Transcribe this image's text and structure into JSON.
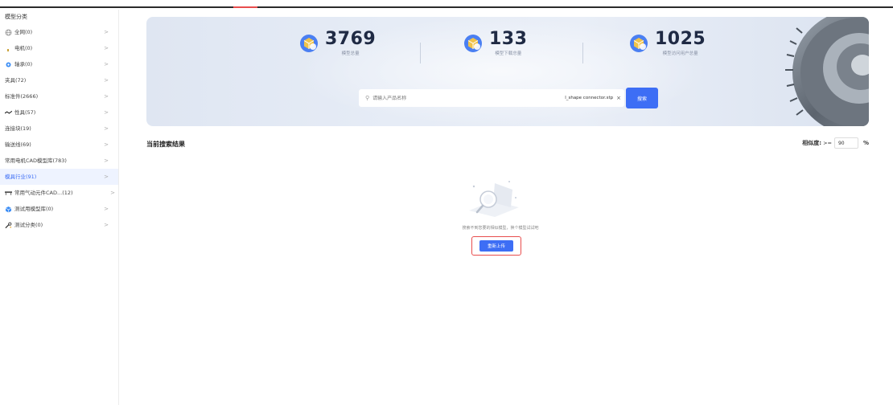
{
  "sidebar": {
    "title": "模型分类",
    "items": [
      {
        "label": "全网(0)",
        "icon": "globe-icon"
      },
      {
        "label": "电机(0)",
        "icon": "motor-icon"
      },
      {
        "label": "轴承(0)",
        "icon": "bearing-icon"
      },
      {
        "label": "夹具(72)",
        "icon": ""
      },
      {
        "label": "标准件(2666)",
        "icon": ""
      },
      {
        "label": "性具(57)",
        "icon": "tool-icon"
      },
      {
        "label": "连接块(19)",
        "icon": ""
      },
      {
        "label": "输送线(69)",
        "icon": ""
      },
      {
        "label": "常用电机CAD模型库(783)",
        "icon": ""
      },
      {
        "label": "模具行业(91)",
        "icon": "",
        "active": true
      },
      {
        "label": "常用气动元件CAD...(12)",
        "icon": "cylinder-icon"
      },
      {
        "label": "测试用模型库(0)",
        "icon": "box-icon"
      },
      {
        "label": "测试分类(0)",
        "icon": "wrench-icon"
      }
    ],
    "chevron": ">"
  },
  "stats": [
    {
      "value": "3769",
      "label": "模型总量"
    },
    {
      "value": "133",
      "label": "模型下载总量"
    },
    {
      "value": "1025",
      "label": "模型访问用户总量"
    }
  ],
  "search": {
    "placeholder": "请输入产品名称",
    "file_name": "l_shape connector.stp",
    "clear": "×",
    "button": "搜索"
  },
  "results": {
    "title": "当前搜索结果",
    "similarity_label": "相似度:",
    "similarity_op": ">=",
    "similarity_value": "90",
    "similarity_unit": "%"
  },
  "empty": {
    "message": "搜索不到您要的相似模型，换个模型试试吧",
    "upload_button": "重新上传"
  },
  "colors": {
    "accent": "#3d6ef5",
    "highlight": "#e84d4d"
  }
}
